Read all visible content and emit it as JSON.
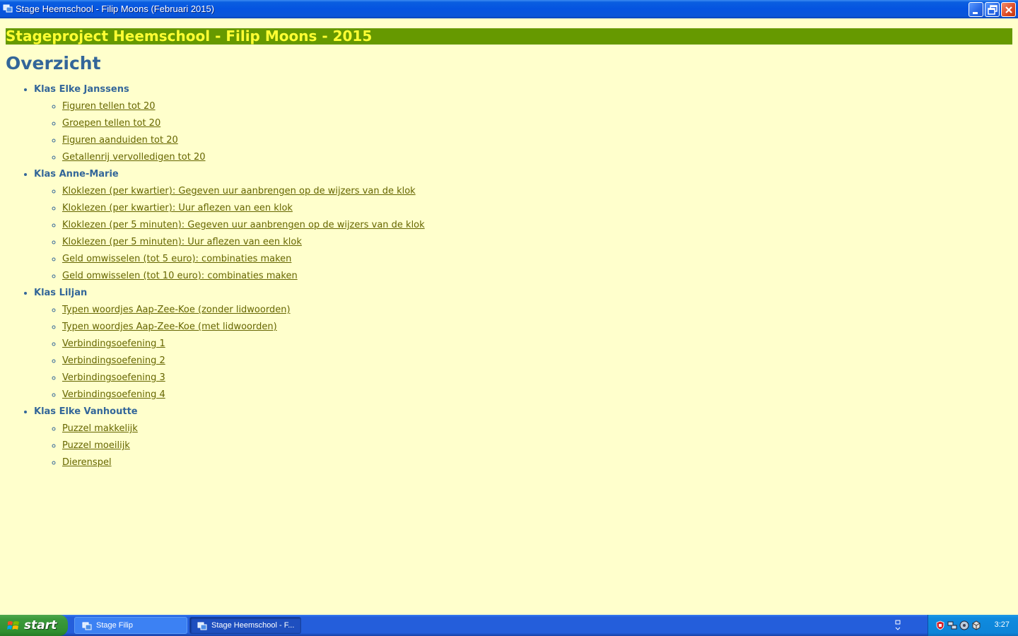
{
  "window": {
    "title": "Stage Heemschool - Filip Moons (Februari 2015)",
    "icon": "app-window-icon"
  },
  "page": {
    "banner": "Stageproject Heemschool - Filip Moons - 2015",
    "heading": "Overzicht",
    "classes": [
      {
        "name": "Klas Elke Janssens",
        "exercises": [
          "Figuren tellen tot 20",
          "Groepen tellen tot 20",
          "Figuren aanduiden tot 20",
          "Getallenrij vervolledigen tot 20"
        ]
      },
      {
        "name": "Klas Anne-Marie",
        "exercises": [
          "Kloklezen (per kwartier): Gegeven uur aanbrengen op de wijzers van de klok",
          "Kloklezen (per kwartier): Uur aflezen van een klok",
          "Kloklezen (per 5 minuten): Gegeven uur aanbrengen op de wijzers van de klok",
          "Kloklezen (per 5 minuten): Uur aflezen van een klok",
          "Geld omwisselen (tot 5 euro): combinaties maken",
          "Geld omwisselen (tot 10 euro): combinaties maken"
        ]
      },
      {
        "name": "Klas Liljan",
        "exercises": [
          "Typen woordjes Aap-Zee-Koe (zonder lidwoorden)",
          "Typen woordjes Aap-Zee-Koe (met lidwoorden)",
          "Verbindingsoefening 1",
          "Verbindingsoefening 2",
          "Verbindingsoefening 3",
          "Verbindingsoefening 4"
        ]
      },
      {
        "name": "Klas Elke Vanhoutte",
        "exercises": [
          "Puzzel makkelijk",
          "Puzzel moeilijk",
          "Dierenspel"
        ]
      }
    ]
  },
  "taskbar": {
    "start_label": "start",
    "tasks": [
      {
        "label": "Stage Filip",
        "active": false
      },
      {
        "label": "Stage Heemschool - F...",
        "active": true
      }
    ],
    "clock": "3:27"
  },
  "colors": {
    "page_background": "#ffffcc",
    "banner_background": "#669900",
    "banner_text": "#ffff33",
    "heading": "#336699",
    "link": "#666600"
  }
}
